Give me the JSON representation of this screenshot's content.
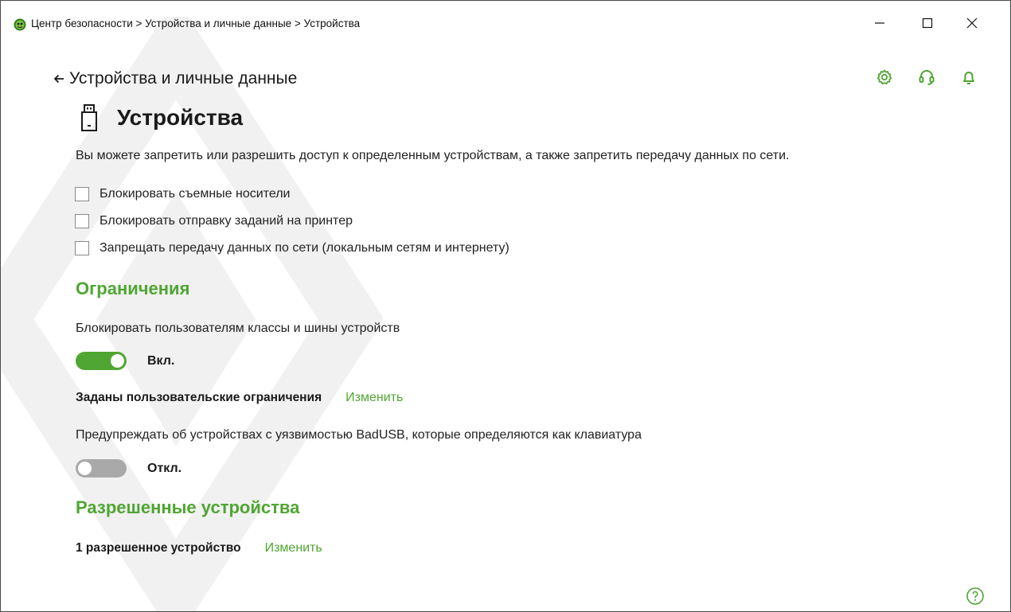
{
  "window": {
    "title": "Центр безопасности > Устройства и личные данные > Устройства"
  },
  "header": {
    "back_label": "Устройства и личные данные"
  },
  "page": {
    "title": "Устройства",
    "description": "Вы можете запретить или разрешить доступ к определенным устройствам, а также запретить передачу данных по сети."
  },
  "options": [
    {
      "label": "Блокировать съемные носители",
      "checked": false
    },
    {
      "label": "Блокировать отправку заданий на принтер",
      "checked": false
    },
    {
      "label": "Запрещать передачу данных по сети (локальным сетям и интернету)",
      "checked": false
    }
  ],
  "restrictions": {
    "heading": "Ограничения",
    "block_classes_label": "Блокировать пользователям классы и шины устройств",
    "block_classes_toggle": {
      "state": "on",
      "label": "Вкл."
    },
    "user_restrictions_text": "Заданы пользовательские ограничения",
    "user_restrictions_link": "Изменить",
    "badusb_label": "Предупреждать об устройствах с уязвимостью BadUSB, которые определяются как клавиатура",
    "badusb_toggle": {
      "state": "off",
      "label": "Откл."
    }
  },
  "allowed": {
    "heading": "Разрешенные устройства",
    "count_text": "1 разрешенное устройство",
    "link": "Изменить"
  },
  "icons": {
    "app": "dr-web-spider-icon",
    "settings": "gear-icon",
    "support": "headset-icon",
    "notifications": "bell-icon",
    "help": "help-icon"
  },
  "colors": {
    "accent": "#4fa632",
    "toggle_off": "#a9a9a9",
    "text": "#1a1a1a"
  }
}
